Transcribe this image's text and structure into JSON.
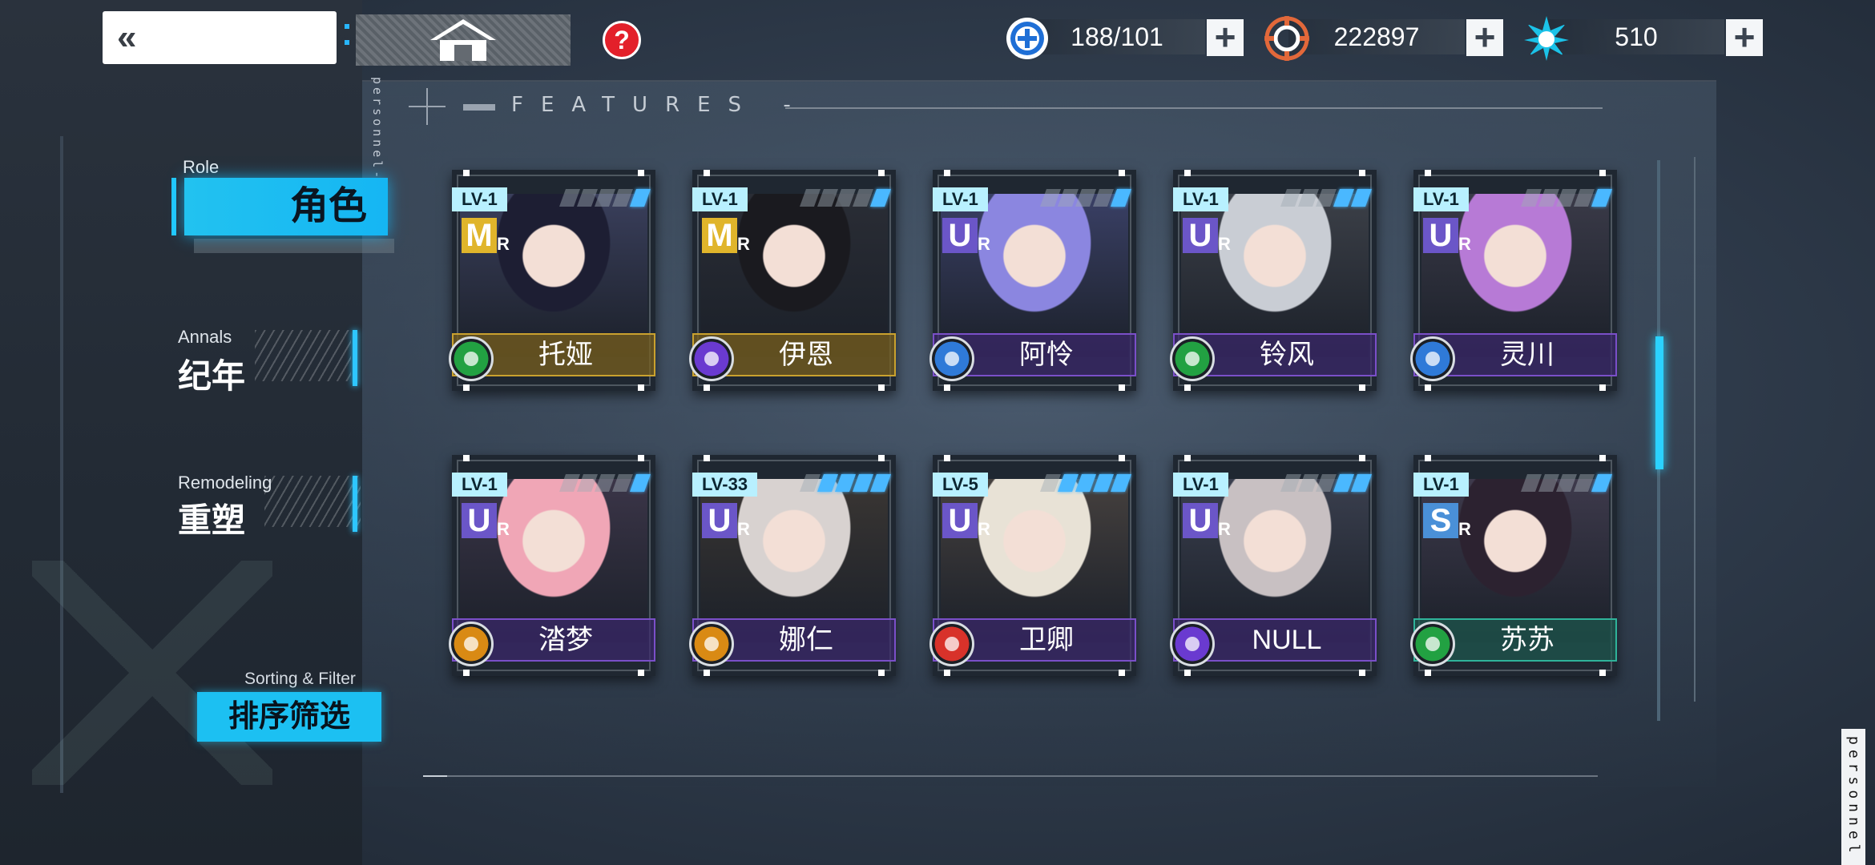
{
  "side_text_top": "personnel-files",
  "side_text_bottom": "personnel",
  "header": {
    "help_label": "?",
    "resources": [
      {
        "icon": "stamina-plus-icon",
        "value": "188/101",
        "color": "#1f6fd6"
      },
      {
        "icon": "target-coin-icon",
        "value": "222897",
        "color": "#e2683a"
      },
      {
        "icon": "crystal-burst-icon",
        "value": "510",
        "color": "#1bc2e8"
      }
    ],
    "plus_label": "+"
  },
  "features_label": "FEATURES -",
  "nav": {
    "role": {
      "en": "Role",
      "cn": "角色"
    },
    "annals": {
      "en": "Annals",
      "cn": "纪年"
    },
    "remodeling": {
      "en": "Remodeling",
      "cn": "重塑"
    },
    "sort": {
      "en": "Sorting & Filter",
      "cn": "排序筛选"
    }
  },
  "cards": [
    {
      "level": "LV-1",
      "rarity": "M",
      "stars": 1,
      "name": "托娅",
      "element": "wind",
      "elem_color": "#22a142",
      "frame": "gold",
      "bg": "#3a3f5c",
      "hair": "#1d1e33"
    },
    {
      "level": "LV-1",
      "rarity": "M",
      "stars": 1,
      "name": "伊恩",
      "element": "void",
      "elem_color": "#6a3ad0",
      "frame": "gold",
      "bg": "#2a2d35",
      "hair": "#1a1a1f"
    },
    {
      "level": "LV-1",
      "rarity": "U",
      "stars": 1,
      "name": "阿怜",
      "element": "water",
      "elem_color": "#2f7ad8",
      "frame": "purple",
      "bg": "#3a4066",
      "hair": "#8b86e0"
    },
    {
      "level": "LV-1",
      "rarity": "U",
      "stars": 2,
      "name": "铃风",
      "element": "wind",
      "elem_color": "#22a142",
      "frame": "purple",
      "bg": "#3c4048",
      "hair": "#c9cdd4"
    },
    {
      "level": "LV-1",
      "rarity": "U",
      "stars": 1,
      "name": "灵川",
      "element": "water",
      "elem_color": "#2f7ad8",
      "frame": "purple",
      "bg": "#3a3a48",
      "hair": "#b77ad6"
    },
    {
      "level": "LV-1",
      "rarity": "U",
      "stars": 1,
      "name": "涾梦",
      "element": "thunder",
      "elem_color": "#d98a14",
      "frame": "purple",
      "bg": "#3b3548",
      "hair": "#f0a6b6"
    },
    {
      "level": "LV-33",
      "rarity": "U",
      "stars": 4,
      "name": "娜仁",
      "element": "thunder",
      "elem_color": "#d98a14",
      "frame": "purple",
      "bg": "#3a3633",
      "hair": "#d8d2d0"
    },
    {
      "level": "LV-5",
      "rarity": "U",
      "stars": 4,
      "name": "卫卿",
      "element": "fire",
      "elem_color": "#d8322a",
      "frame": "purple",
      "bg": "#45403e",
      "hair": "#e8e2d6"
    },
    {
      "level": "LV-1",
      "rarity": "U",
      "stars": 2,
      "name": "NULL",
      "element": "void",
      "elem_color": "#6a3ad0",
      "frame": "purple",
      "bg": "#3a3f4e",
      "hair": "#c8c0c2"
    },
    {
      "level": "LV-1",
      "rarity": "S",
      "stars": 1,
      "name": "苏苏",
      "element": "wind",
      "elem_color": "#22a142",
      "frame": "teal",
      "bg": "#3e3a4c",
      "hair": "#2c2230"
    }
  ]
}
